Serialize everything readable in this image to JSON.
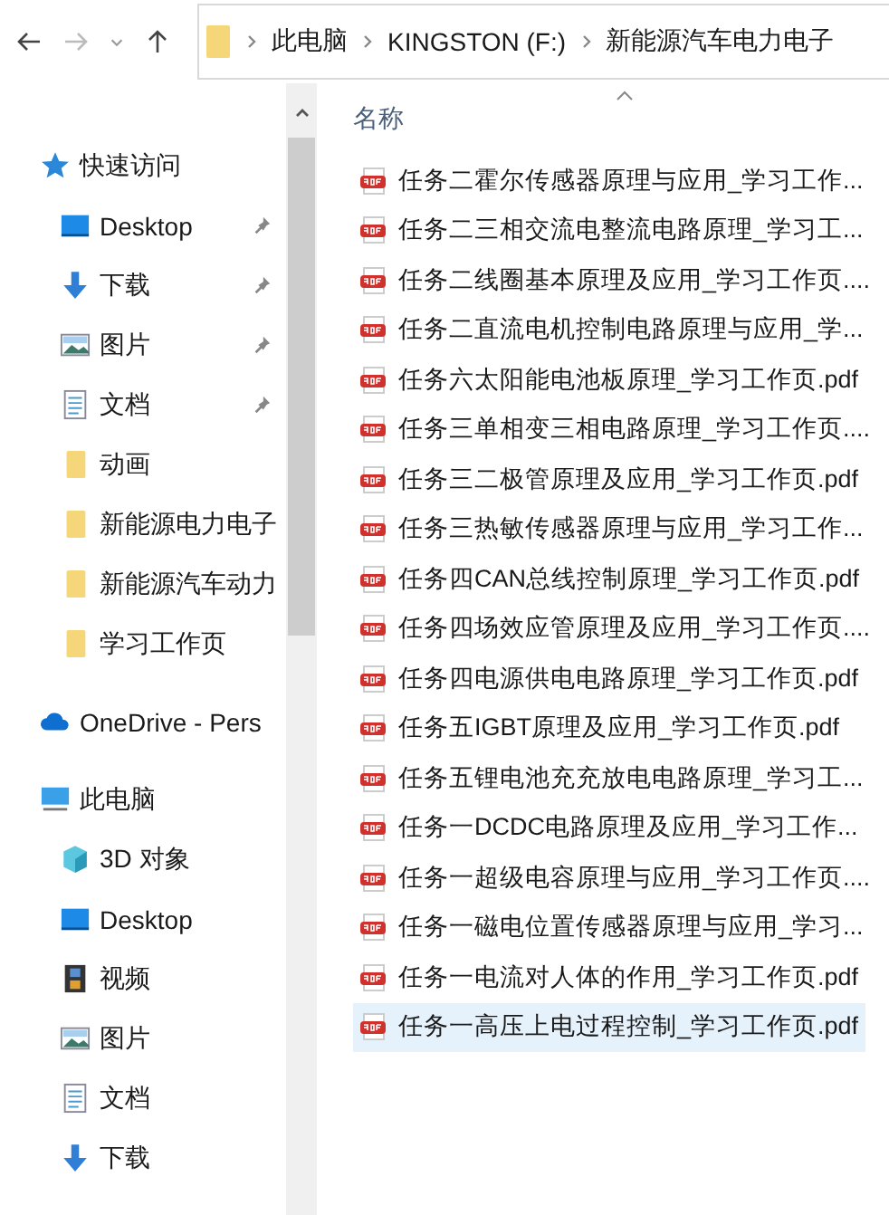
{
  "address_bar": {
    "segments": [
      "此电脑",
      "KINGSTON (F:)",
      "新能源汽车电力电子"
    ]
  },
  "navigation": {
    "sections": [
      {
        "label": "快速访问",
        "kind": "star",
        "children": [
          {
            "label": "Desktop",
            "kind": "desktop",
            "pinned": true
          },
          {
            "label": "下载",
            "kind": "download",
            "pinned": true
          },
          {
            "label": "图片",
            "kind": "pictures",
            "pinned": true
          },
          {
            "label": "文档",
            "kind": "documents",
            "pinned": true
          },
          {
            "label": "动画",
            "kind": "folder",
            "pinned": false
          },
          {
            "label": "新能源电力电子",
            "kind": "folder",
            "pinned": false
          },
          {
            "label": "新能源汽车动力",
            "kind": "folder",
            "pinned": false
          },
          {
            "label": "学习工作页",
            "kind": "folder",
            "pinned": false
          }
        ]
      },
      {
        "label": "OneDrive - Pers",
        "kind": "cloud"
      },
      {
        "label": "此电脑",
        "kind": "pc",
        "children": [
          {
            "label": "3D 对象",
            "kind": "cube",
            "pinned": false
          },
          {
            "label": "Desktop",
            "kind": "desktop",
            "pinned": false
          },
          {
            "label": "视频",
            "kind": "video",
            "pinned": false
          },
          {
            "label": "图片",
            "kind": "pictures",
            "pinned": false
          },
          {
            "label": "文档",
            "kind": "documents",
            "pinned": false
          },
          {
            "label": "下载",
            "kind": "download",
            "pinned": false
          }
        ]
      }
    ]
  },
  "file_list": {
    "column": "名称",
    "files": [
      {
        "name": "任务二霍尔传感器原理与应用_学习工作...",
        "selected": false
      },
      {
        "name": "任务二三相交流电整流电路原理_学习工...",
        "selected": false
      },
      {
        "name": "任务二线圈基本原理及应用_学习工作页....",
        "selected": false
      },
      {
        "name": "任务二直流电机控制电路原理与应用_学...",
        "selected": false
      },
      {
        "name": "任务六太阳能电池板原理_学习工作页.pdf",
        "selected": false
      },
      {
        "name": "任务三单相变三相电路原理_学习工作页....",
        "selected": false
      },
      {
        "name": "任务三二极管原理及应用_学习工作页.pdf",
        "selected": false
      },
      {
        "name": "任务三热敏传感器原理与应用_学习工作...",
        "selected": false
      },
      {
        "name": "任务四CAN总线控制原理_学习工作页.pdf",
        "selected": false
      },
      {
        "name": "任务四场效应管原理及应用_学习工作页....",
        "selected": false
      },
      {
        "name": "任务四电源供电电路原理_学习工作页.pdf",
        "selected": false
      },
      {
        "name": "任务五IGBT原理及应用_学习工作页.pdf",
        "selected": false
      },
      {
        "name": "任务五锂电池充充放电电路原理_学习工...",
        "selected": false
      },
      {
        "name": "任务一DCDC电路原理及应用_学习工作...",
        "selected": false
      },
      {
        "name": "任务一超级电容原理与应用_学习工作页....",
        "selected": false
      },
      {
        "name": "任务一磁电位置传感器原理与应用_学习...",
        "selected": false
      },
      {
        "name": "任务一电流对人体的作用_学习工作页.pdf",
        "selected": false
      },
      {
        "name": "任务一高压上电过程控制_学习工作页.pdf",
        "selected": true
      }
    ]
  }
}
